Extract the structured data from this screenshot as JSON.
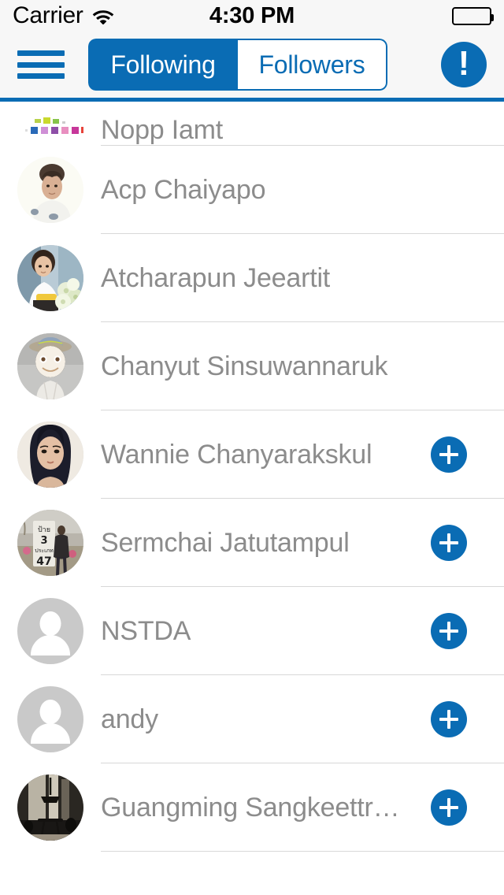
{
  "status_bar": {
    "carrier": "Carrier",
    "wifi_icon": "wifi-icon",
    "time": "4:30 PM",
    "battery_icon": "battery-full-icon"
  },
  "nav_bar": {
    "menu_icon": "hamburger-menu-icon",
    "alert_icon": "exclamation-icon",
    "segments": [
      {
        "label": "Following",
        "selected": true
      },
      {
        "label": "Followers",
        "selected": false
      }
    ]
  },
  "colors": {
    "accent_blue": "#0a6cb4",
    "status_bar_bg": "#f7f7f7",
    "name_text": "#8c8c8c",
    "separator": "#d8d8d8",
    "placeholder_avatar": "#c9c9c9"
  },
  "list": {
    "rows": [
      {
        "name": "Nopp Iamt",
        "avatar": "pixel-logo-avatar",
        "has_add_button": false,
        "clipped": true
      },
      {
        "name": "Acp Chaiyapo",
        "avatar": "photo-avatar",
        "has_add_button": false,
        "clipped": false
      },
      {
        "name": "Atcharapun Jeeartit",
        "avatar": "photo-avatar",
        "has_add_button": false,
        "clipped": false
      },
      {
        "name": "Chanyut Sinsuwannaruk",
        "avatar": "photo-avatar",
        "has_add_button": false,
        "clipped": false
      },
      {
        "name": "Wannie Chanyarakskul",
        "avatar": "photo-avatar",
        "has_add_button": true,
        "clipped": false
      },
      {
        "name": "Sermchai Jatutampul",
        "avatar": "photo-avatar",
        "has_add_button": true,
        "clipped": false
      },
      {
        "name": "NSTDA",
        "avatar": "default-person-avatar",
        "has_add_button": true,
        "clipped": false
      },
      {
        "name": "andy",
        "avatar": "default-person-avatar",
        "has_add_button": true,
        "clipped": false
      },
      {
        "name": "Guangming Sangkeettr…",
        "avatar": "photo-avatar",
        "has_add_button": true,
        "clipped": false
      }
    ],
    "add_button_label": "follow-add-button"
  }
}
